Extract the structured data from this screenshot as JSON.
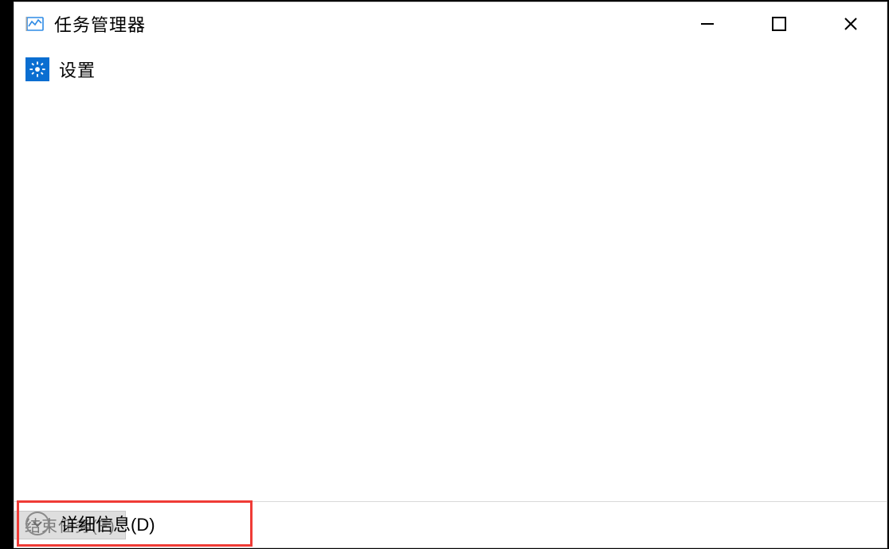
{
  "titlebar": {
    "app_title": "任务管理器"
  },
  "process_list": {
    "items": [
      {
        "name": "设置",
        "icon": "gear-icon"
      }
    ]
  },
  "footer": {
    "details_label": "详细信息(D)",
    "end_task_label": "结束任务(E)"
  },
  "colors": {
    "accent": "#0a6ed1",
    "highlight_border": "#ef3b36",
    "disabled_text": "#7a7a7a",
    "disabled_bg": "#dedede"
  }
}
